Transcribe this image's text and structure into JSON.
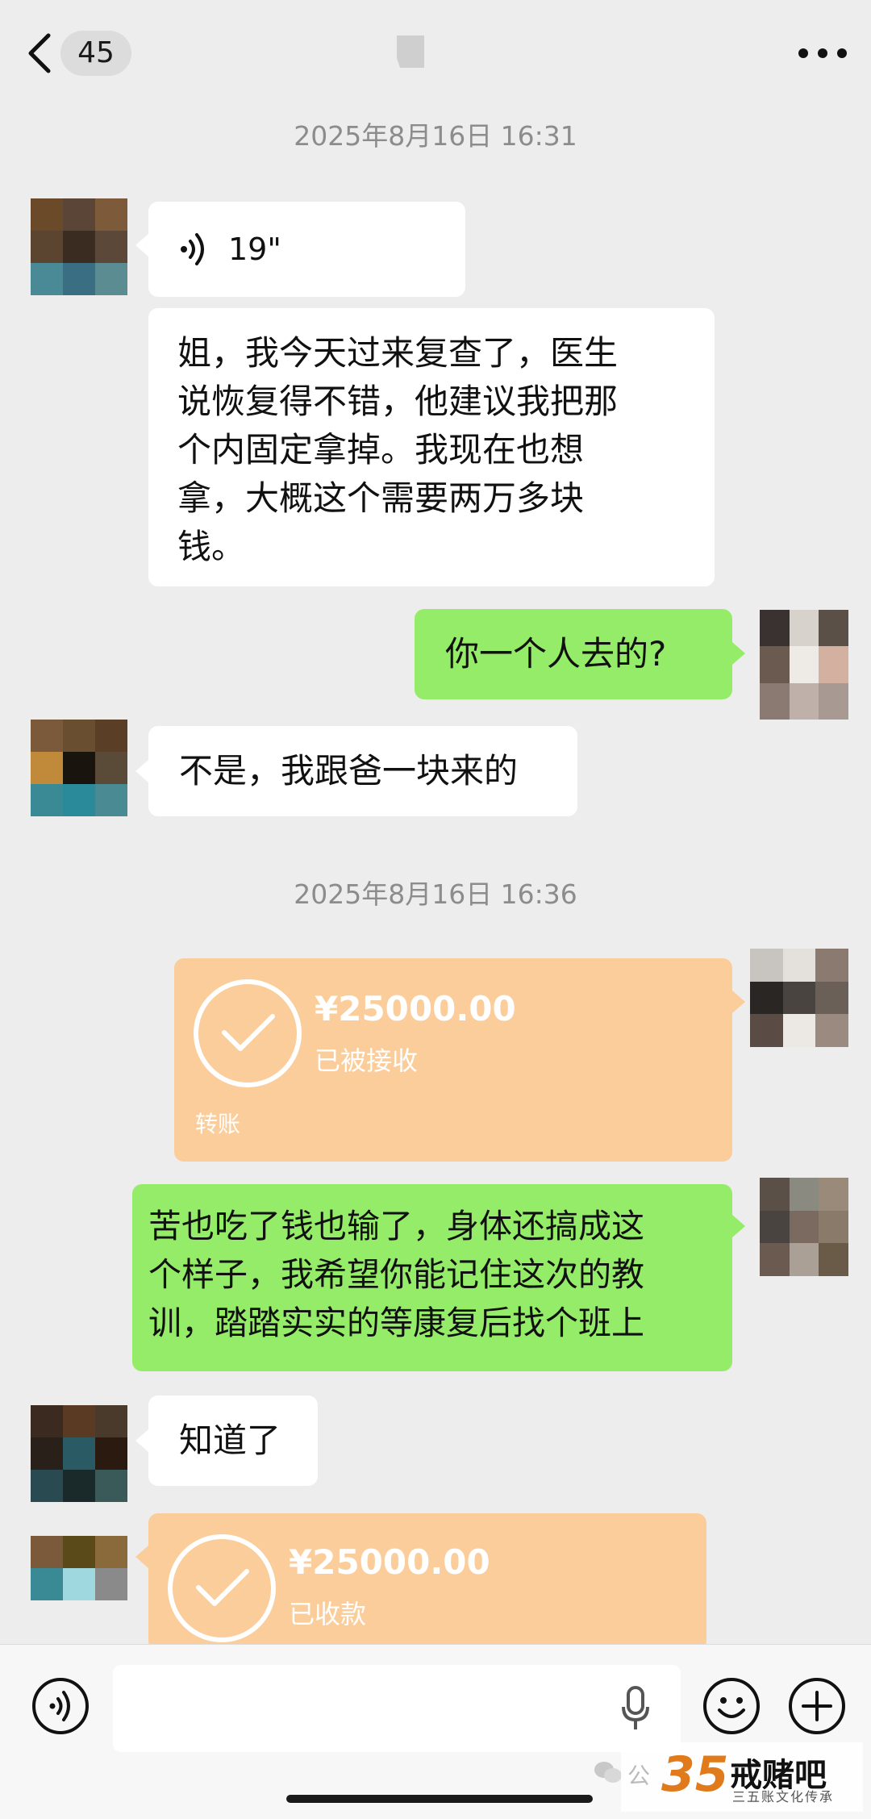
{
  "header": {
    "unread_count": "45"
  },
  "timestamps": [
    "2025年8月16日 16:31",
    "2025年8月16日 16:36"
  ],
  "messages": {
    "voice_duration": "19\"",
    "msg1_lines": [
      "姐，我今天过来复查了，医生",
      "说恢复得不错，他建议我把那",
      "个内固定拿掉。我现在也想",
      "拿，大概这个需要两万多块",
      "钱。"
    ],
    "msg2": "你一个人去的?",
    "msg3": "不是，我跟爸一块来的",
    "transfer1": {
      "amount": "¥25000.00",
      "status": "已被接收",
      "label": "转账"
    },
    "msg4_lines": [
      "苦也吃了钱也输了，身体还搞成这",
      "个样子，我希望你能记住这次的教",
      "训，踏踏实实的等康复后找个班上"
    ],
    "msg5": "知道了",
    "transfer2": {
      "amount": "¥25000.00",
      "status": "已收款"
    }
  },
  "watermark": {
    "logo": "35",
    "title": "戒赌吧",
    "subtitle": "三五账文化传承",
    "prefix": "公"
  },
  "colors": {
    "background": "#ededed",
    "sent_bubble": "#95ec69",
    "received_bubble": "#ffffff",
    "transfer_bubble": "#fbcd9b"
  }
}
